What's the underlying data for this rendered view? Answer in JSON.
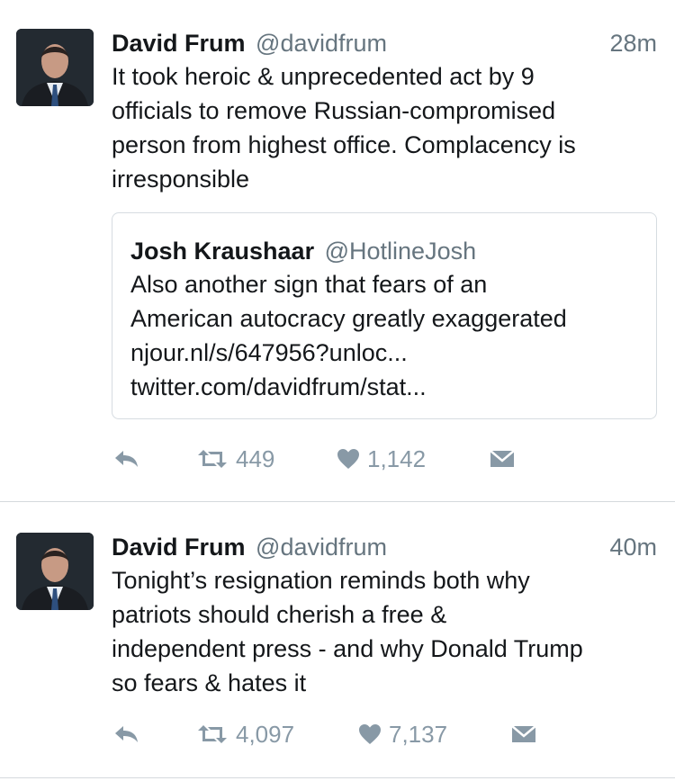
{
  "tweets": [
    {
      "author": {
        "name": "David Frum",
        "handle": "@davidfrum"
      },
      "time": "28m",
      "text_lines": [
        "It took heroic & unprecedented act by 9",
        "officials to remove Russian-compromised",
        "person from highest office. Complacency is",
        "irresponsible"
      ],
      "quoted": {
        "name": "Josh Kraushaar",
        "handle": "@HotlineJosh",
        "text_lines": [
          "Also another sign that fears of an",
          "American autocracy greatly exaggerated",
          "njour.nl/s/647956?unloc...",
          "twitter.com/davidfrum/stat..."
        ]
      },
      "retweets": "449",
      "likes": "1,142"
    },
    {
      "author": {
        "name": "David Frum",
        "handle": "@davidfrum"
      },
      "time": "40m",
      "text_lines": [
        "Tonight’s resignation reminds both why",
        "patriots should cherish a free &",
        "independent press - and why Donald Trump",
        "so fears & hates it"
      ],
      "retweets": "4,097",
      "likes": "7,137"
    }
  ],
  "icons": {
    "reply": "reply-icon",
    "retweet": "retweet-icon",
    "like": "heart-icon",
    "message": "envelope-icon"
  },
  "colors": {
    "text": "#14171a",
    "secondary": "#66757f",
    "action": "#8899a6",
    "border": "#d6dce1"
  }
}
